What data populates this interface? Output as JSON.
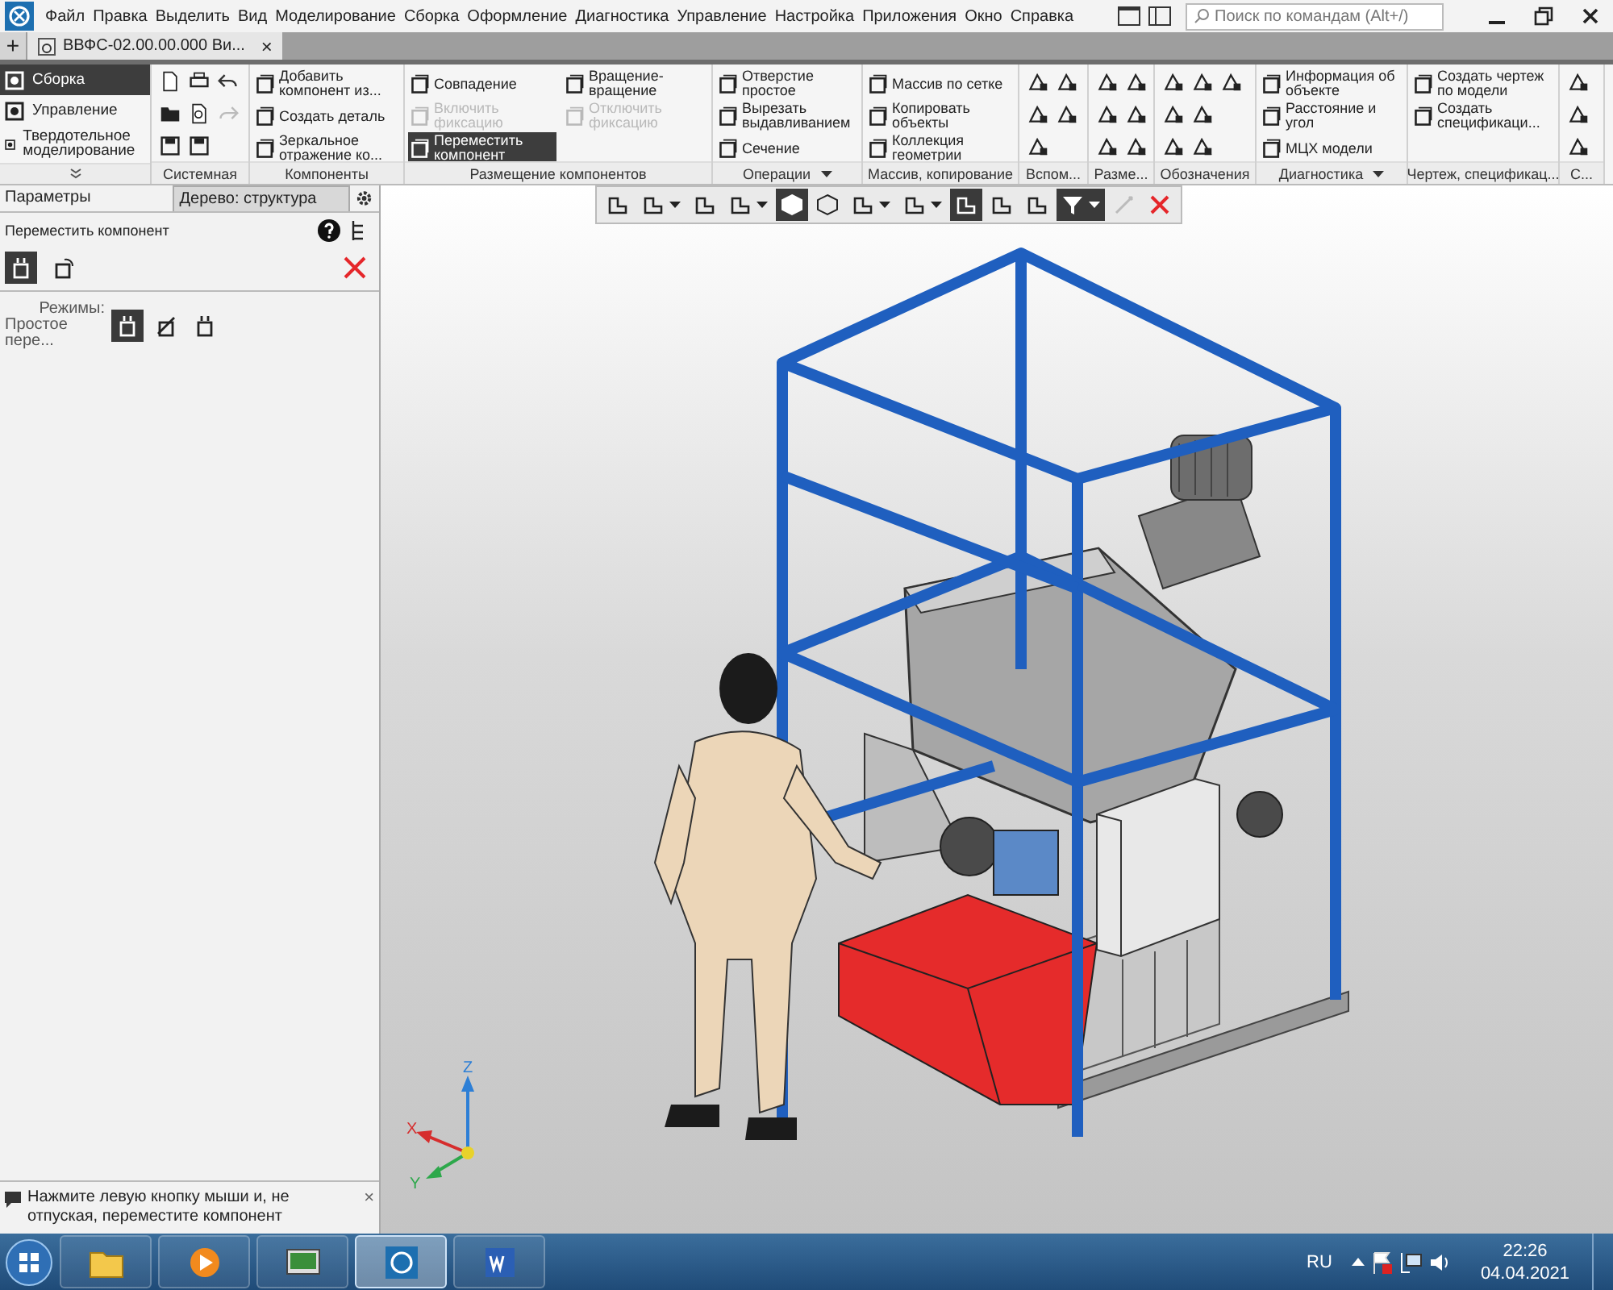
{
  "menu": [
    "Файл",
    "Правка",
    "Выделить",
    "Вид",
    "Моделирование",
    "Сборка",
    "Оформление",
    "Диагностика",
    "Управление",
    "Настройка",
    "Приложения",
    "Окно",
    "Справка"
  ],
  "search": {
    "placeholder": "Поиск по командам (Alt+/)"
  },
  "tab_bar": {
    "add": "+",
    "tabs": [
      {
        "title": "ВВФС-02.00.00.000 Ви...",
        "close": "×",
        "selected": true
      }
    ]
  },
  "ribbon": {
    "modes": [
      {
        "label": "Сборка",
        "selected": true
      },
      {
        "label": "Управление",
        "selected": false
      },
      {
        "label": "Твердотельное моделирование",
        "selected": false
      }
    ],
    "groups": [
      {
        "label": "Системная",
        "kind": "icons"
      },
      {
        "label": "Компоненты",
        "kind": "text",
        "items": [
          {
            "label": "Добавить компонент из...",
            "disabled": false,
            "selected": false
          },
          {
            "label": "Создать деталь",
            "disabled": false,
            "selected": false
          },
          {
            "label": "Зеркальное отражение ко...",
            "disabled": false,
            "selected": false
          }
        ]
      },
      {
        "label": "Размещение компонентов",
        "kind": "text",
        "items": [
          {
            "label": "Совпадение",
            "disabled": false,
            "selected": false
          },
          {
            "label": "Включить фиксацию",
            "disabled": true,
            "selected": false
          },
          {
            "label": "Переместить компонент",
            "disabled": false,
            "selected": true
          },
          {
            "label": "Вращение-вращение",
            "disabled": false,
            "selected": false
          },
          {
            "label": "Отключить фиксацию",
            "disabled": true,
            "selected": false
          }
        ]
      },
      {
        "label": "Операции",
        "kind": "text",
        "dropdown": true,
        "items": [
          {
            "label": "Отверстие простое",
            "disabled": false,
            "selected": false
          },
          {
            "label": "Вырезать выдавливанием",
            "disabled": false,
            "selected": false
          },
          {
            "label": "Сечение",
            "disabled": false,
            "selected": false
          }
        ]
      },
      {
        "label": "Массив, копирование",
        "kind": "text",
        "items": [
          {
            "label": "Массив по сетке",
            "disabled": false,
            "selected": false
          },
          {
            "label": "Копировать объекты",
            "disabled": false,
            "selected": false
          },
          {
            "label": "Коллекция геометрии",
            "disabled": false,
            "selected": false
          }
        ]
      },
      {
        "label": "Вспом...",
        "kind": "icons"
      },
      {
        "label": "Разме...",
        "kind": "icons"
      },
      {
        "label": "Обозначения",
        "kind": "icons"
      },
      {
        "label": "Диагностика",
        "kind": "text",
        "dropdown": true,
        "items": [
          {
            "label": "Информация об объекте",
            "disabled": false,
            "selected": false
          },
          {
            "label": "Расстояние и угол",
            "disabled": false,
            "selected": false
          },
          {
            "label": "МЦХ модели",
            "disabled": false,
            "selected": false
          }
        ]
      },
      {
        "label": "Чертеж, спецификац...",
        "kind": "text",
        "items": [
          {
            "label": "Создать чертеж по модели",
            "disabled": false,
            "selected": false
          },
          {
            "label": "Создать спецификаци...",
            "disabled": false,
            "selected": false
          }
        ]
      },
      {
        "label": "С...",
        "kind": "icons"
      }
    ]
  },
  "panel": {
    "tabs": [
      {
        "label": "Параметры",
        "selected": true
      },
      {
        "label": "Дерево: структура",
        "selected": false
      }
    ],
    "title": "Переместить компонент",
    "tool_buttons": [
      {
        "selected": true
      },
      {
        "selected": false
      }
    ],
    "modes_label": "Режимы:",
    "modes_value": "Простое пере...",
    "mode_buttons": [
      {
        "selected": true
      },
      {
        "selected": false
      },
      {
        "selected": false
      }
    ],
    "hint": "Нажмите левую кнопку мыши и, не отпуская, переместите компонент",
    "hint_close": "×"
  },
  "view_toolbar": [
    {
      "selected": false
    },
    {
      "selected": false
    },
    {
      "selected": false
    },
    {
      "selected": false
    },
    {
      "selected": true
    },
    {
      "selected": false
    },
    {
      "selected": false
    },
    {
      "selected": false
    },
    {
      "selected": true
    },
    {
      "selected": false
    },
    {
      "selected": false
    },
    {
      "selected": true
    },
    {
      "selected": false
    },
    {
      "selected": false
    }
  ],
  "axes": {
    "x": "X",
    "y": "Y",
    "z": "Z"
  },
  "taskbar": {
    "apps": [
      {
        "selected": false
      },
      {
        "selected": false
      },
      {
        "selected": false
      },
      {
        "selected": true
      },
      {
        "selected": false
      }
    ],
    "language": "RU",
    "time": "22:26",
    "date": "04.04.2021"
  }
}
